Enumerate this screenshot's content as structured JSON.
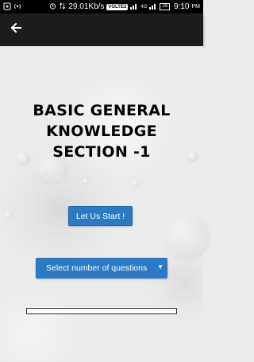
{
  "status_bar": {
    "speed": "29.01Kb/s",
    "volte": "VOLTE2",
    "network": "4G",
    "battery": "29",
    "time": "9:10",
    "time_suffix": "PM"
  },
  "app_bar": {
    "back_icon": "arrow-left-icon"
  },
  "main": {
    "title_line1": "BASIC GENERAL",
    "title_line2": "KNOWLEDGE",
    "title_line3": "SECTION -1",
    "start_button": "Let Us Start !",
    "question_select": {
      "selected": "Select number of questions",
      "caret_icon": "caret-down-icon"
    },
    "progress": 0
  },
  "colors": {
    "accent": "#2a7bc3",
    "app_bar": "#1d1d1d",
    "status_bar": "#000000"
  }
}
